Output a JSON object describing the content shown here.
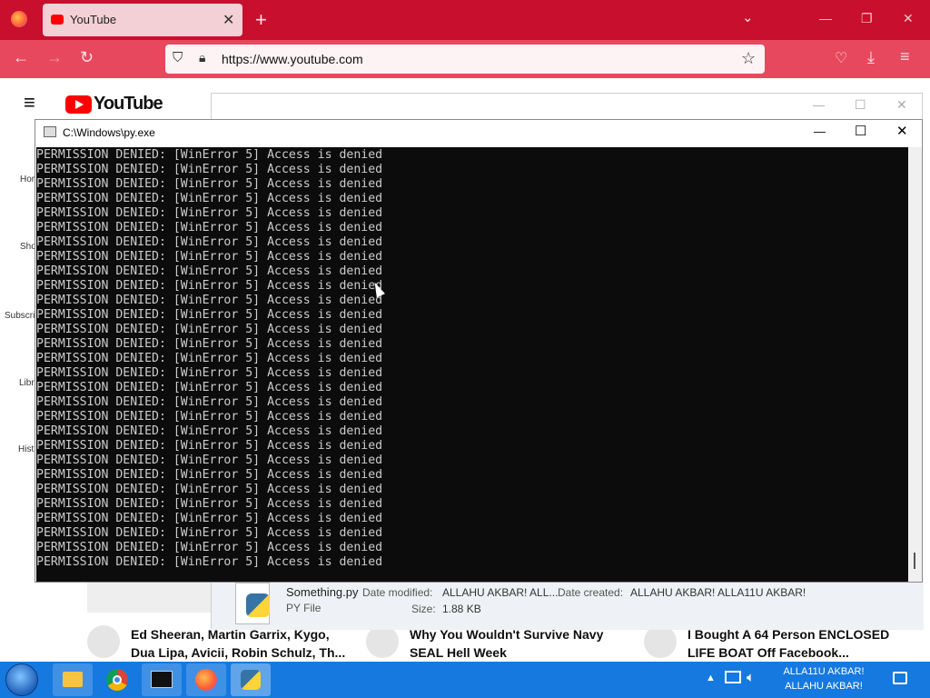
{
  "browser": {
    "tab_title": "YouTube",
    "url": "https://www.youtube.com"
  },
  "youtube": {
    "logo_text": "YouTube",
    "sidebar": [
      {
        "label": "Hor"
      },
      {
        "label": "Sho"
      },
      {
        "label": "Subscri"
      },
      {
        "label": "Libr"
      },
      {
        "label": "Hist"
      }
    ],
    "cards": [
      {
        "title_line1": "Ed Sheeran, Martin Garrix, Kygo,",
        "title_line2": "Dua Lipa, Avicii, Robin Schulz, Th..."
      },
      {
        "title_line1": "Why You Wouldn't Survive Navy",
        "title_line2": "SEAL Hell Week"
      },
      {
        "title_line1": "I Bought A 64 Person ENCLOSED",
        "title_line2": "LIFE BOAT Off Facebook..."
      }
    ]
  },
  "explorer": {
    "file_name": "Something.py",
    "file_type": "PY File",
    "date_modified_label": "Date modified:",
    "date_modified_value": "ALLAHU AKBAR! ALL...",
    "date_created_label": "Date created:",
    "date_created_value": "ALLAHU AKBAR! ALLA11U AKBAR!",
    "size_label": "Size:",
    "size_value": "1.88 KB"
  },
  "console": {
    "title": "C:\\Windows\\py.exe",
    "line_text": "PERMISSION DENIED: [WinError 5] Access is denied",
    "line_count": 29
  },
  "taskbar": {
    "clock_line1": "ALLA11U AKBAR!",
    "clock_line2": "ALLAHU AKBAR!"
  },
  "colors": {
    "firefox_tabbar": "#c8102e",
    "firefox_navbar": "#e8485e",
    "console_bg": "#0c0c0c",
    "taskbar": "#1679e0",
    "youtube_red": "#ff0000"
  }
}
